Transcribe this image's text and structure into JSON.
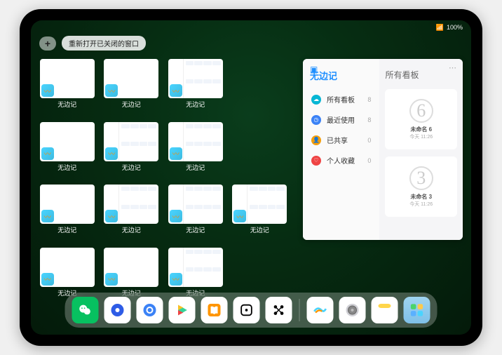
{
  "status": {
    "battery": "100%"
  },
  "topbar": {
    "plus": "+",
    "recent": "重新打开已关闭的窗口"
  },
  "windows": {
    "label": "无边记"
  },
  "panel": {
    "title": "无边记",
    "menu": [
      {
        "label": "所有看板",
        "count": "8"
      },
      {
        "label": "最近使用",
        "count": "8"
      },
      {
        "label": "已共享",
        "count": "0"
      },
      {
        "label": "个人收藏",
        "count": "0"
      }
    ],
    "right_title": "所有看板",
    "boards": [
      {
        "glyph": "6",
        "name": "未命名 6",
        "time": "今天 11:26"
      },
      {
        "glyph": "3",
        "name": "未命名 3",
        "time": "今天 11:26"
      }
    ]
  },
  "dock": {
    "apps": [
      "wechat",
      "quark",
      "qqbrowser",
      "play",
      "books",
      "die",
      "connect",
      "freeform",
      "settings",
      "notes",
      "apps-folder"
    ]
  }
}
